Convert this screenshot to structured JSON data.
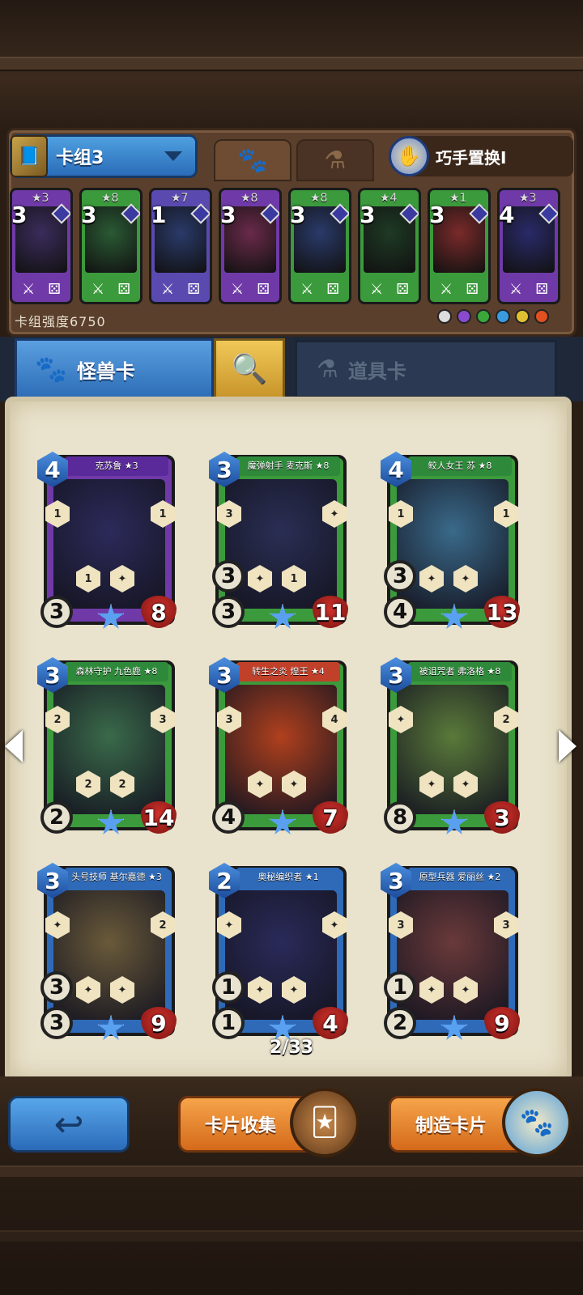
{
  "deck": {
    "name": "卡组3",
    "power_label": "卡组强度6750",
    "swap_label": "巧手置换I",
    "mini_cards": [
      {
        "cost": "3",
        "stars": "★3",
        "frame": "#6f3aa8",
        "art": "#3b2c5c"
      },
      {
        "cost": "3",
        "stars": "★8",
        "frame": "#3b9a3b",
        "art": "#2a5a34"
      },
      {
        "cost": "1",
        "stars": "★7",
        "frame": "#5a4ab0",
        "art": "#2a3a6a"
      },
      {
        "cost": "3",
        "stars": "★8",
        "frame": "#6f3aa8",
        "art": "#6a2a4a"
      },
      {
        "cost": "3",
        "stars": "★8",
        "frame": "#3b9a3b",
        "art": "#2a3a6a"
      },
      {
        "cost": "3",
        "stars": "★4",
        "frame": "#3b9a3b",
        "art": "#1e3a24"
      },
      {
        "cost": "3",
        "stars": "★1",
        "frame": "#3b9a3b",
        "art": "#7a2a2a"
      },
      {
        "cost": "4",
        "stars": "★3",
        "frame": "#6f3aa8",
        "art": "#2a2a6a"
      }
    ],
    "faction_colors": [
      "#dddddd",
      "#8a4ad0",
      "#3aa83a",
      "#3a9ae0",
      "#e0c030",
      "#e05020"
    ]
  },
  "tabs": {
    "monster_label": "怪兽卡",
    "item_label": "道具卡"
  },
  "cards": [
    {
      "name": "克苏鲁 ★3",
      "cost": "4",
      "attack": "3",
      "health": "8",
      "frame": "#6f3aa8",
      "art": "#2c2a5a",
      "ribbon": "#5a2a9a",
      "hexes": [
        "1",
        "1",
        "1",
        ""
      ],
      "shield": ""
    },
    {
      "name": "魔弹射手 麦克斯 ★8",
      "cost": "3",
      "attack": "3",
      "health": "11",
      "frame": "#3b9a3b",
      "art": "#2a2e54",
      "ribbon": "#2e8a3a",
      "hexes": [
        "3",
        "",
        "",
        "1"
      ],
      "shield": "3"
    },
    {
      "name": "鲛人女王 苏 ★8",
      "cost": "4",
      "attack": "4",
      "health": "13",
      "frame": "#3b9a3b",
      "art": "#3a6a8a",
      "ribbon": "#2e8a3a",
      "hexes": [
        "1",
        "1",
        "",
        ""
      ],
      "shield": "3"
    },
    {
      "name": "森林守护 九色鹿 ★8",
      "cost": "3",
      "attack": "2",
      "health": "14",
      "frame": "#3b9a3b",
      "art": "#3a6a4a",
      "ribbon": "#2e8a3a",
      "hexes": [
        "2",
        "3",
        "2",
        "2"
      ],
      "shield": ""
    },
    {
      "name": "转生之炎 煌王 ★4",
      "cost": "3",
      "attack": "4",
      "health": "7",
      "frame": "#3b9a3b",
      "art": "#b0401e",
      "ribbon": "#c0402a",
      "hexes": [
        "3",
        "4",
        "",
        ""
      ],
      "shield": ""
    },
    {
      "name": "被诅咒者 弗洛格 ★8",
      "cost": "3",
      "attack": "8",
      "health": "3",
      "frame": "#3b9a3b",
      "art": "#5a7a3a",
      "ribbon": "#2e8a3a",
      "hexes": [
        "",
        "2",
        "",
        ""
      ],
      "shield": ""
    },
    {
      "name": "头号技师 基尔嘉德 ★3",
      "cost": "3",
      "attack": "3",
      "health": "9",
      "frame": "#2e6ab8",
      "art": "#6a5a3a",
      "ribbon": "#2e6ab8",
      "hexes": [
        "",
        "2",
        "",
        ""
      ],
      "shield": "3"
    },
    {
      "name": "奥秘编织者 ★1",
      "cost": "2",
      "attack": "1",
      "health": "4",
      "frame": "#2e6ab8",
      "art": "#2a2a5a",
      "ribbon": "#2e6ab8",
      "hexes": [
        "",
        "",
        "",
        ""
      ],
      "shield": "1"
    },
    {
      "name": "原型兵器 爱丽丝 ★2",
      "cost": "3",
      "attack": "2",
      "health": "9",
      "frame": "#2e6ab8",
      "art": "#6a3a3a",
      "ribbon": "#2e6ab8",
      "hexes": [
        "3",
        "3",
        "",
        ""
      ],
      "shield": "1"
    }
  ],
  "pagination": {
    "label": "2/33"
  },
  "bottom": {
    "collect_label": "卡片收集",
    "craft_label": "制造卡片"
  }
}
